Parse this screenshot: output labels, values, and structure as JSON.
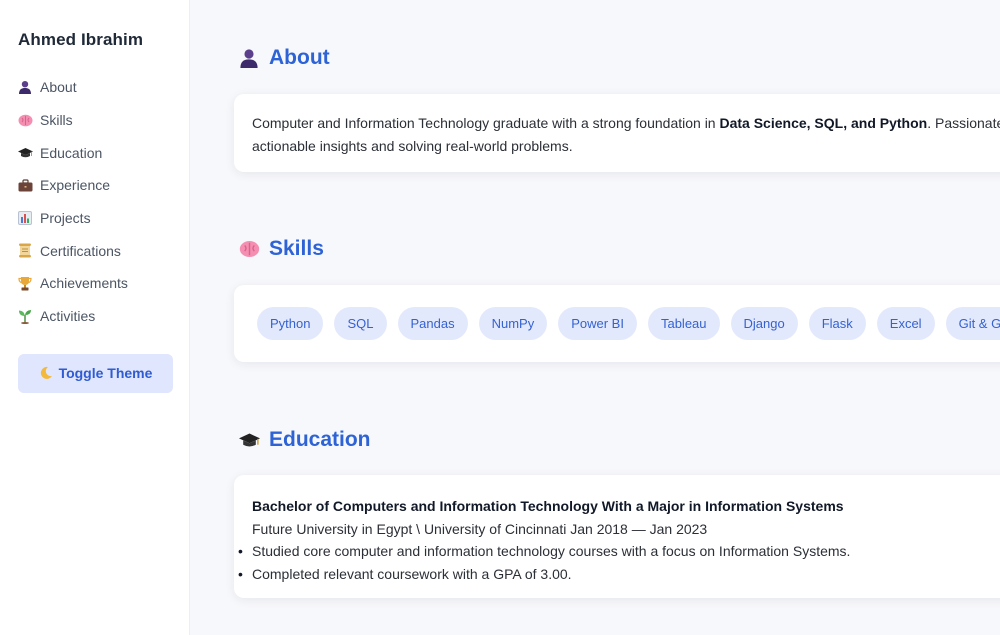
{
  "sidebar": {
    "name": "Ahmed Ibrahim",
    "nav": [
      {
        "label": "About",
        "icon": "person-icon"
      },
      {
        "label": "Skills",
        "icon": "brain-icon"
      },
      {
        "label": "Education",
        "icon": "graduation-cap-icon"
      },
      {
        "label": "Experience",
        "icon": "briefcase-icon"
      },
      {
        "label": "Projects",
        "icon": "bar-chart-icon"
      },
      {
        "label": "Certifications",
        "icon": "scroll-icon"
      },
      {
        "label": "Achievements",
        "icon": "trophy-icon"
      },
      {
        "label": "Activities",
        "icon": "seedling-icon"
      }
    ],
    "toggle": {
      "label": "Toggle Theme",
      "icon": "crescent-moon-icon"
    }
  },
  "about": {
    "title": "About",
    "text_1": "Computer and Information Technology graduate with a strong foundation in ",
    "bold": "Data Science, SQL, and Python",
    "text_2": ". Passionate about",
    "line_2": "actionable insights and solving real-world problems."
  },
  "skills": {
    "title": "Skills",
    "items": [
      "Python",
      "SQL",
      "Pandas",
      "NumPy",
      "Power BI",
      "Tableau",
      "Django",
      "Flask",
      "Excel",
      "Git & GitHub"
    ]
  },
  "education": {
    "title": "Education",
    "degree": "Bachelor of Computers and Information Technology With a Major in Information Systems",
    "school": "Future University in Egypt \\ University of Cincinnati Jan 2018 — Jan 2023",
    "bullets": [
      "Studied core computer and information technology courses with a focus on Information Systems.",
      "Completed relevant coursework with a GPA of 3.00."
    ]
  },
  "colors": {
    "accent": "#2e63d6",
    "chip_bg": "#e3e9fc",
    "button_bg": "#dfe6fd",
    "page_bg": "#f7f8fb"
  }
}
